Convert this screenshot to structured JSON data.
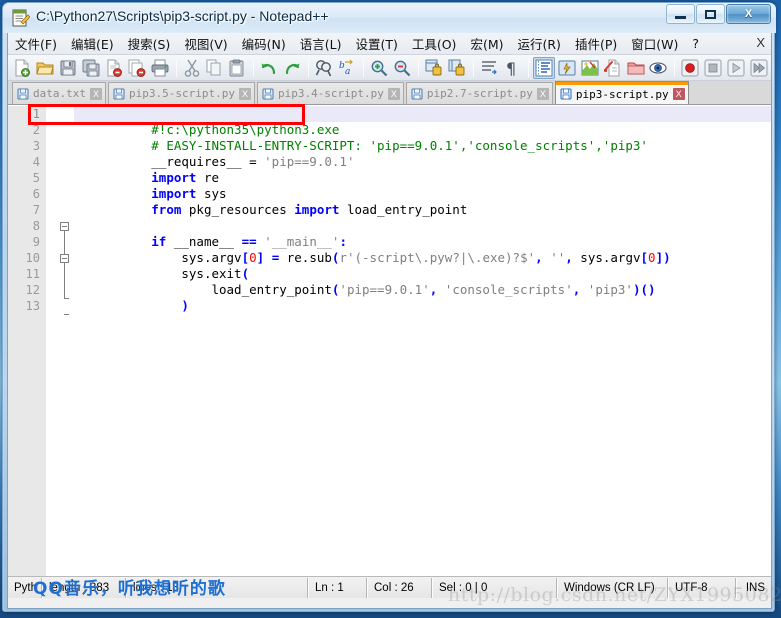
{
  "window": {
    "title": "C:\\Python27\\Scripts\\pip3-script.py - Notepad++",
    "icon": "notepad-plus-plus-icon",
    "controls": {
      "minimize": "minimize-icon",
      "maximize": "maximize-icon",
      "close": "X"
    }
  },
  "menu": {
    "items": [
      "文件(F)",
      "编辑(E)",
      "搜索(S)",
      "视图(V)",
      "编码(N)",
      "语言(L)",
      "设置(T)",
      "工具(O)",
      "宏(M)",
      "运行(R)",
      "插件(P)",
      "窗口(W)",
      "?"
    ],
    "close_x": "X"
  },
  "toolbar": {
    "groups": [
      [
        "new-file-icon",
        "open-file-icon",
        "save-icon",
        "save-all-icon",
        "close-file-icon",
        "close-all-icon",
        "print-icon"
      ],
      [
        "cut-icon",
        "copy-icon",
        "paste-icon"
      ],
      [
        "undo-icon",
        "redo-icon"
      ],
      [
        "find-icon",
        "replace-icon"
      ],
      [
        "zoom-in-icon",
        "zoom-out-icon"
      ],
      [
        "sync-vertical-scroll-icon",
        "sync-horizontal-scroll-icon"
      ],
      [
        "word-wrap-icon",
        "show-all-characters-icon"
      ],
      [
        "indent-guide-icon",
        "user-defined-language-icon",
        "document-map-icon",
        "function-list-icon",
        "folder-as-workspace-icon",
        "monitoring-icon"
      ],
      [
        "record-macro-icon",
        "stop-recording-icon",
        "play-macro-icon",
        "run-macro-multiple-icon"
      ]
    ]
  },
  "tabs": [
    {
      "label": "data.txt",
      "active": false,
      "close": "X",
      "icon": "saved-document-icon"
    },
    {
      "label": "pip3.5-script.py",
      "active": false,
      "close": "X",
      "icon": "saved-document-icon"
    },
    {
      "label": "pip3.4-script.py",
      "active": false,
      "close": "X",
      "icon": "saved-document-icon"
    },
    {
      "label": "pip2.7-script.py",
      "active": false,
      "close": "X",
      "icon": "saved-document-icon"
    },
    {
      "label": "pip3-script.py",
      "active": true,
      "close": "X",
      "icon": "saved-document-icon"
    }
  ],
  "editor": {
    "line_numbers": [
      "1",
      "2",
      "3",
      "4",
      "5",
      "6",
      "7",
      "8",
      "9",
      "10",
      "11",
      "12",
      "13"
    ],
    "current_line": 1,
    "annotation": {
      "shape": "rectangle",
      "color": "#ff0000",
      "target_line": 1
    },
    "lines": [
      {
        "n": "1",
        "tokens": [
          {
            "t": "#!c:\\python35\\python3.exe",
            "c": "cmt"
          }
        ]
      },
      {
        "n": "2",
        "tokens": [
          {
            "t": "# EASY-INSTALL-ENTRY-SCRIPT: 'pip==9.0.1','console_scripts','pip3'",
            "c": "cmt"
          }
        ]
      },
      {
        "n": "3",
        "tokens": [
          {
            "t": "__requires__",
            "c": "dfl"
          },
          {
            "t": " = ",
            "c": "dfl"
          },
          {
            "t": "'pip==9.0.1'",
            "c": "str"
          }
        ]
      },
      {
        "n": "4",
        "tokens": [
          {
            "t": "import",
            "c": "k"
          },
          {
            "t": " re",
            "c": "dfl"
          }
        ]
      },
      {
        "n": "5",
        "tokens": [
          {
            "t": "import",
            "c": "k"
          },
          {
            "t": " sys",
            "c": "dfl"
          }
        ]
      },
      {
        "n": "6",
        "tokens": [
          {
            "t": "from",
            "c": "k"
          },
          {
            "t": " pkg_resources ",
            "c": "dfl"
          },
          {
            "t": "import",
            "c": "k"
          },
          {
            "t": " load_entry_point",
            "c": "dfl"
          }
        ]
      },
      {
        "n": "7",
        "tokens": []
      },
      {
        "n": "8",
        "tokens": [
          {
            "t": "if",
            "c": "k"
          },
          {
            "t": " __name__ ",
            "c": "dfl"
          },
          {
            "t": "==",
            "c": "op"
          },
          {
            "t": " ",
            "c": "dfl"
          },
          {
            "t": "'__main__'",
            "c": "str"
          },
          {
            "t": ":",
            "c": "op"
          }
        ]
      },
      {
        "n": "9",
        "tokens": [
          {
            "t": "    sys.argv",
            "c": "dfl"
          },
          {
            "t": "[",
            "c": "op"
          },
          {
            "t": "0",
            "c": "num"
          },
          {
            "t": "]",
            "c": "op"
          },
          {
            "t": " ",
            "c": "dfl"
          },
          {
            "t": "=",
            "c": "op"
          },
          {
            "t": " re.sub",
            "c": "dfl"
          },
          {
            "t": "(",
            "c": "op"
          },
          {
            "t": "r'(-script\\.pyw?|\\.exe)?$'",
            "c": "str"
          },
          {
            "t": ",",
            "c": "op"
          },
          {
            "t": " ",
            "c": "dfl"
          },
          {
            "t": "''",
            "c": "str"
          },
          {
            "t": ",",
            "c": "op"
          },
          {
            "t": " sys.argv",
            "c": "dfl"
          },
          {
            "t": "[",
            "c": "op"
          },
          {
            "t": "0",
            "c": "num"
          },
          {
            "t": "])",
            "c": "op"
          }
        ]
      },
      {
        "n": "10",
        "tokens": [
          {
            "t": "    sys.exit",
            "c": "dfl"
          },
          {
            "t": "(",
            "c": "op"
          }
        ]
      },
      {
        "n": "11",
        "tokens": [
          {
            "t": "        load_entry_point",
            "c": "dfl"
          },
          {
            "t": "(",
            "c": "op"
          },
          {
            "t": "'pip==9.0.1'",
            "c": "str"
          },
          {
            "t": ",",
            "c": "op"
          },
          {
            "t": " ",
            "c": "dfl"
          },
          {
            "t": "'console_scripts'",
            "c": "str"
          },
          {
            "t": ",",
            "c": "op"
          },
          {
            "t": " ",
            "c": "dfl"
          },
          {
            "t": "'pip3'",
            "c": "str"
          },
          {
            "t": ")()",
            "c": "op"
          }
        ]
      },
      {
        "n": "12",
        "tokens": [
          {
            "t": "    ",
            "c": "dfl"
          },
          {
            "t": ")",
            "c": "op"
          }
        ]
      },
      {
        "n": "13",
        "tokens": []
      }
    ]
  },
  "statusbar": {
    "language": "Pyth",
    "length": "length : 383",
    "lines": "lines : 13",
    "ln": "Ln : 1",
    "col": "Col : 26",
    "sel": "Sel : 0 | 0",
    "eol": "Windows (CR LF)",
    "encoding": "UTF-8",
    "insert_mode": "INS"
  },
  "watermarks": {
    "qq": "QQ音乐，听我想听的歌",
    "url": "http://blog.csdn.net/ZYX1995082"
  },
  "colors": {
    "accent_tab": "#ff9900",
    "annotation": "#ff0000",
    "comment": "#008000",
    "keyword": "#0000ff",
    "string": "#808080",
    "number": "#ff0000",
    "current_line_bg": "#e9e9f8"
  }
}
